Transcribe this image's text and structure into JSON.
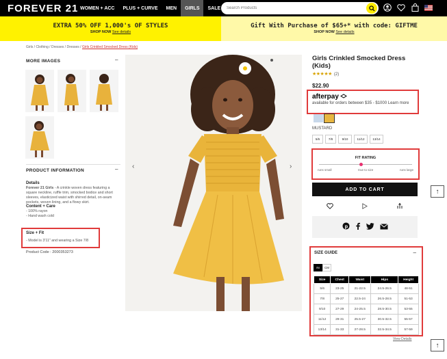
{
  "header": {
    "logo": "FOREVER 21",
    "nav": [
      "WOMEN + ACC",
      "PLUS + CURVE",
      "MEN",
      "GIRLS",
      "SALE"
    ],
    "active_nav": "GIRLS",
    "search_placeholder": "Search Products",
    "icons": [
      "search-icon",
      "account-icon",
      "heart-icon",
      "bag-icon",
      "us-flag-icon"
    ]
  },
  "promo": {
    "left_title": "EXTRA 50% OFF 1,000's OF STYLES",
    "left_sub": "SHOP NOW",
    "left_link": "See details",
    "right_title": "Gift With Purchase of $65+* with code: GIFTME",
    "right_sub": "SHOP NOW",
    "right_link": "See details",
    "colors": {
      "left": "#fff200",
      "right": "#fff9a8"
    }
  },
  "breadcrumb": {
    "path": "Girls / Clothing / Dresses / Dresses /",
    "current": "Girls Crinkled Smocked Dress (Kids)"
  },
  "left": {
    "more_images": "MORE IMAGES",
    "product_info": "PRODUCT INFORMATION",
    "details_heading": "Details",
    "brand": "Forever 21 Girls",
    "description": " - A crinkle woven dress featuring a square neckline, ruffle trim, smocked bodice and short sleeves, elasticized waist with shirred detail, on-seam pockets, woven lining, and a flowy skirt.",
    "content_heading": "Content + Care",
    "content": [
      "- 100% rayon",
      "- Hand wash cold"
    ],
    "size_fit_heading": "Size + Fit",
    "size_fit": "- Model is 3'11\" and wearing a Size 7/8",
    "product_code": "Product Code : 2000353273"
  },
  "product": {
    "title": "Girls Crinkled Smocked Dress (Kids)",
    "stars": "★★★★★",
    "review_count": "(2)",
    "price": "$22.90",
    "afterpay_logo": "afterpay",
    "afterpay_text": " available for orders between $35 - $1000 Learn more",
    "color_label": "MUSTARD",
    "swatch_colors": [
      "#c8d8ea",
      "#e8b640"
    ],
    "sizes": [
      "5/6",
      "7/8",
      "9/10",
      "11/12",
      "13/14"
    ],
    "fit_title": "FIT RATING",
    "fit_labels": [
      "runs small",
      "true to size",
      "runs large"
    ],
    "fit_position": 0.45,
    "add_to_cart": "ADD TO CART"
  },
  "size_guide": {
    "title": "SIZE GUIDE",
    "units": [
      "IN",
      "CM"
    ],
    "headers": [
      "Size",
      "Chest",
      "Waist",
      "Hips",
      "Height"
    ],
    "rows": [
      [
        "5/6",
        "23-25",
        "21-22.5",
        "24.5-26.5",
        "48-51"
      ],
      [
        "7/8",
        "25-27",
        "22.5-24",
        "26.5-28.5",
        "51-53"
      ],
      [
        "9/10",
        "27-29",
        "24-25.5",
        "28.5-30.5",
        "53-55"
      ],
      [
        "11/12",
        "29-31",
        "25.5-27",
        "30.5-32.5",
        "55-57"
      ],
      [
        "13/14",
        "31-33",
        "27-28.5",
        "32.5-34.5",
        "57-59"
      ]
    ],
    "view_details": "View Details"
  }
}
